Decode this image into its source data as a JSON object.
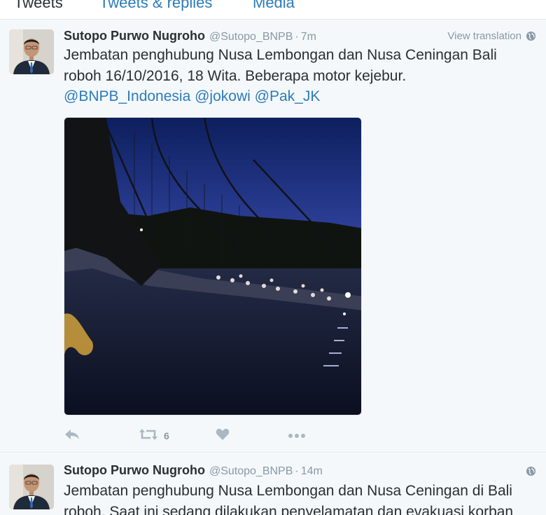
{
  "tabs": [
    {
      "label": "Tweets"
    },
    {
      "label": "Tweets & replies"
    },
    {
      "label": "Media"
    }
  ],
  "tweets": [
    {
      "name": "Sutopo Purwo Nugroho",
      "handle": "@Sutopo_BNPB",
      "dot": "·",
      "time": "7m",
      "translate_label": "View translation",
      "text_line1": "Jembatan penghubung Nusa Lembongan dan Nusa Ceningan Bali",
      "text_line2": "roboh 16/10/2016, 18 Wita. Beberapa motor kejebur.",
      "mentions": [
        "@BNPB_Indonesia",
        "@jokowi",
        "@Pak_JK"
      ],
      "retweet_count": "6",
      "icons": {
        "reply": "reply-icon",
        "retweet": "retweet-icon",
        "like": "heart-icon",
        "more": "more-icon",
        "globe": "globe-icon"
      }
    },
    {
      "name": "Sutopo Purwo Nugroho",
      "handle": "@Sutopo_BNPB",
      "dot": "·",
      "time": "14m",
      "text_line1": "Jembatan penghubung Nusa Lembongan dan Nusa Ceningan di Bali",
      "text_line2": "roboh. Saat ini sedang dilakukan penyelamatan dan evakuasi korban"
    }
  ],
  "colors": {
    "link": "#2b7bb9",
    "muted": "#8899a6",
    "text": "#292f33",
    "background": "#f5f8fa"
  }
}
